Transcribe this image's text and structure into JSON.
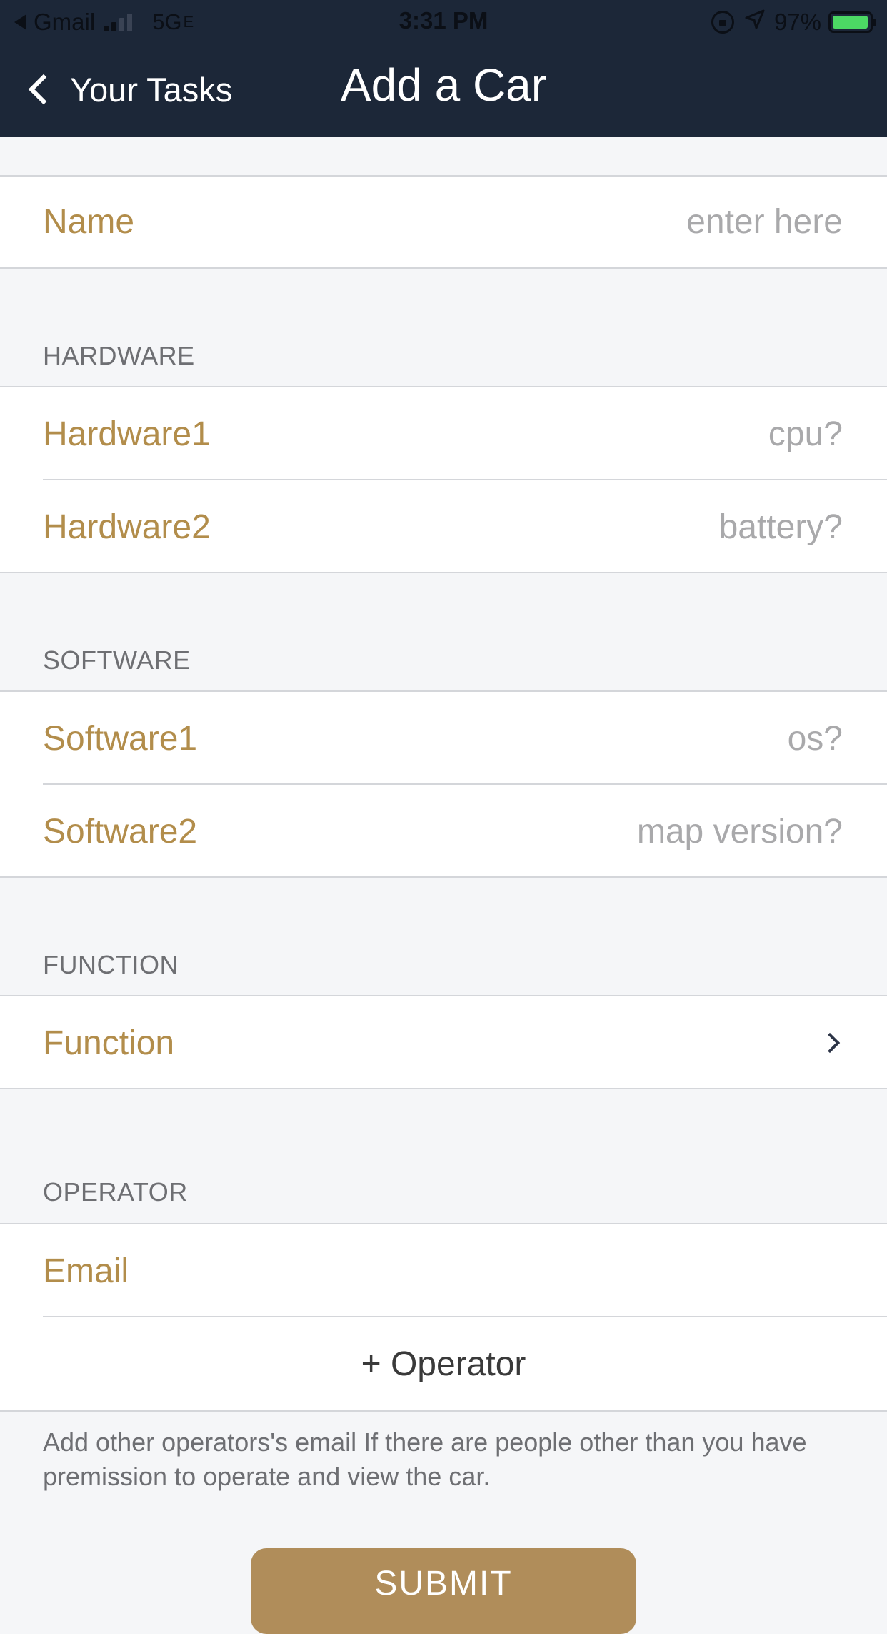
{
  "status_bar": {
    "back_app": "Gmail",
    "network": "5G",
    "network_suffix": "E",
    "time": "3:31 PM",
    "battery_percent": "97%",
    "battery_level": 0.97,
    "icons": [
      "back-triangle-icon",
      "signal-icon",
      "orientation-lock-icon",
      "location-arrow-icon",
      "battery-charging-icon"
    ]
  },
  "nav": {
    "back_label": "Your Tasks",
    "title": "Add a Car"
  },
  "form": {
    "name": {
      "label": "Name",
      "placeholder": "enter here"
    },
    "hardware": {
      "header": "HARDWARE",
      "rows": [
        {
          "label": "Hardware1",
          "placeholder": "cpu?"
        },
        {
          "label": "Hardware2",
          "placeholder": "battery?"
        }
      ]
    },
    "software": {
      "header": "SOFTWARE",
      "rows": [
        {
          "label": "Software1",
          "placeholder": "os?"
        },
        {
          "label": "Software2",
          "placeholder": "map version?"
        }
      ]
    },
    "function": {
      "header": "FUNCTION",
      "label": "Function"
    },
    "operator": {
      "header": "OPERATOR",
      "email_label": "Email",
      "email_value": "",
      "add_label": "+ Operator",
      "footnote": "Add other operators's email If there are people other than you have premission to operate and view the car."
    },
    "submit_label": "SUBMIT"
  },
  "colors": {
    "nav_background": "#1c2738",
    "label_gold": "#b28d4b",
    "placeholder_gray": "#a9a9ab",
    "submit_background": "#b08d5a",
    "page_background": "#f5f6f8"
  }
}
